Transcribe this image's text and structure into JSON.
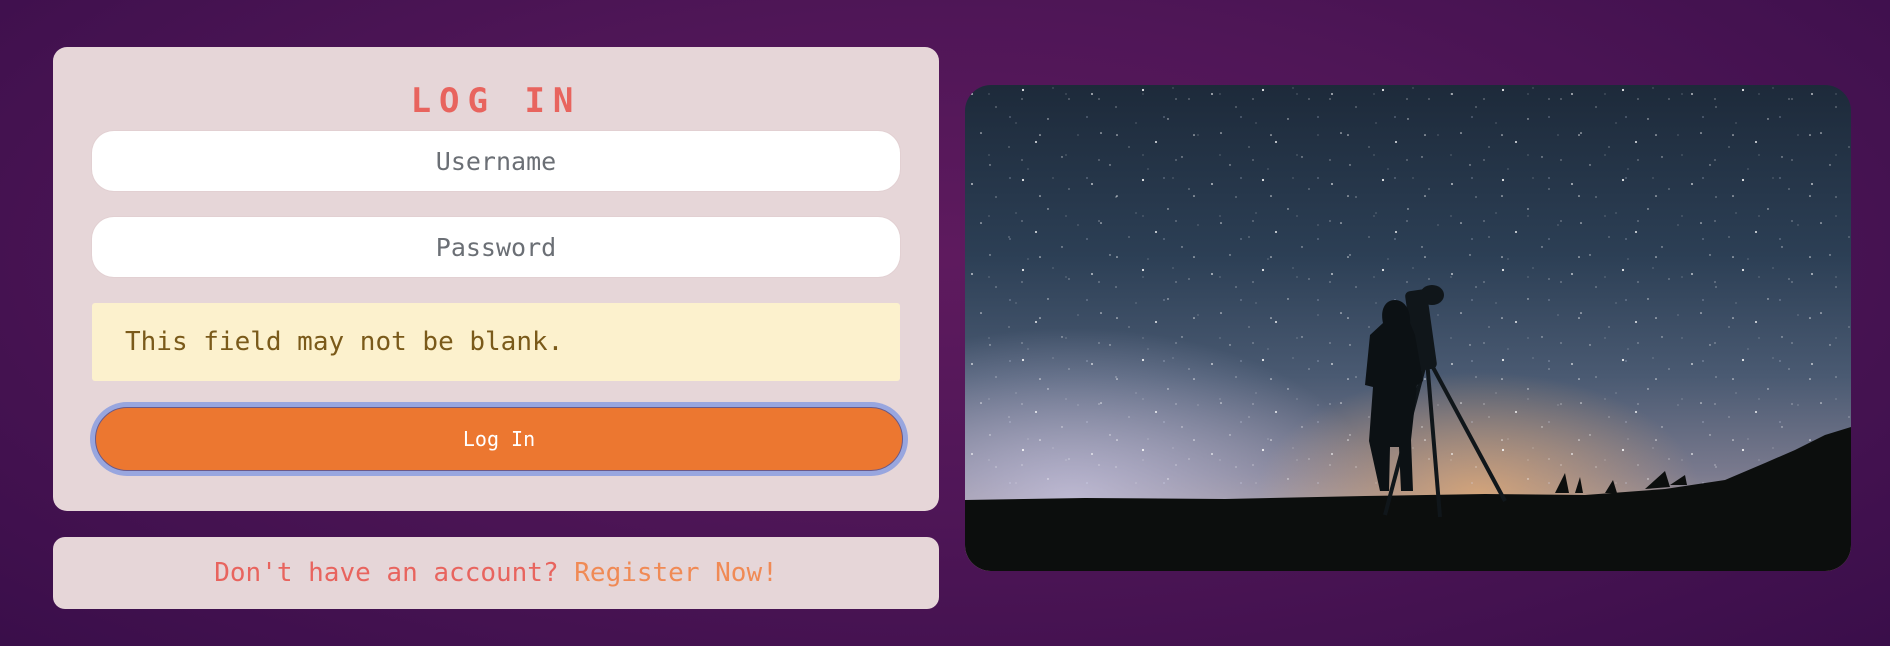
{
  "login": {
    "title": "LOG IN",
    "username_placeholder": "Username",
    "password_placeholder": "Password",
    "error_message": "This field may not be blank.",
    "submit_label": "Log In"
  },
  "register": {
    "prompt": "Don't have an account? ",
    "link_label": "Register Now!"
  },
  "photo": {
    "subject": "astronomer-with-telescope-under-starry-sky"
  },
  "colors": {
    "background": "#4f1657",
    "card": "#e6d6d8",
    "accent": "#ec7730",
    "title": "#e8645e",
    "alert_bg": "#fcf1cd"
  }
}
